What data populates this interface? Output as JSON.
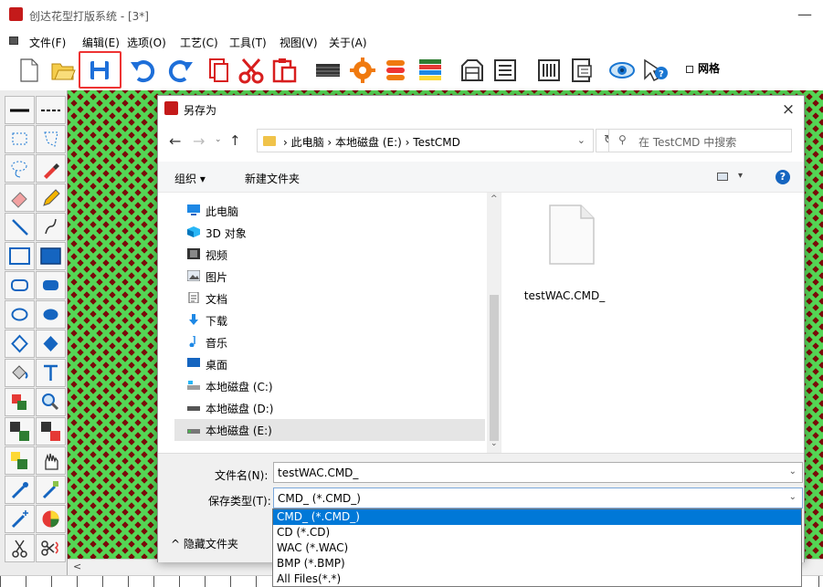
{
  "window": {
    "title": "创达花型打版系统 - [3*]",
    "minimize": "—"
  },
  "menu": [
    "文件(F)",
    "编辑(E)",
    "选项(O)",
    "工艺(C)",
    "工具(T)",
    "视图(V)",
    "关于(A)"
  ],
  "toolbar": {
    "icons": [
      "new-file-icon",
      "open-folder-icon",
      "save-icon",
      "undo-icon",
      "redo-icon",
      "copy-icon",
      "cut-icon",
      "paste-icon",
      "pattern-block-icon",
      "gear-icon",
      "color-sort-icon",
      "color-stripe-icon",
      "machine-icon",
      "list-icon",
      "barcode-icon",
      "print-preview-icon",
      "eye-icon",
      "help-cursor-icon"
    ],
    "grid_label": "网格",
    "colors": {
      "save_frame": "#ee3333",
      "save_icon": "#1e6fd9",
      "cut": "#d81e1e",
      "gear": "#f07a10"
    }
  },
  "left_tools": [
    "line-icon",
    "dashed-line-icon",
    "rect-select-icon",
    "poly-select-icon",
    "lasso-icon",
    "dropper-icon",
    "eraser-icon",
    "pencil-icon",
    "straight-line-icon",
    "curve-icon",
    "rectangle-outline-icon",
    "rectangle-fill-icon",
    "rounded-rect-outline-icon",
    "rounded-rect-fill-icon",
    "ellipse-outline-icon",
    "ellipse-fill-icon",
    "diamond-outline-icon",
    "diamond-fill-icon",
    "fill-bucket-icon",
    "text-icon",
    "color-swap-icon",
    "zoom-icon",
    "pattern-copy-icon",
    "pattern-move-icon",
    "color-replace-icon",
    "hand-icon",
    "spray-icon",
    "spray-brush-icon",
    "magic-icon",
    "color-wheel-icon",
    "scissors-icon",
    "cut-thread-icon"
  ],
  "canvas": {
    "colors": {
      "bg": "#7a0a0a",
      "diamond": "#55d655"
    },
    "hscroll_left": "<"
  },
  "dialog": {
    "title": "另存为",
    "close": "×",
    "address": {
      "crumbs": "›  此电脑  ›  本地磁盘 (E:)  ›  TestCMD",
      "dropdown": "⌄"
    },
    "refresh": "↻",
    "search_placeholder": "在 TestCMD 中搜索",
    "commands": {
      "organize": "组织 ▾",
      "new_folder": "新建文件夹",
      "view_dropdown": "▾",
      "help": "?"
    },
    "nav": [
      {
        "label": "此电脑",
        "icon": "computer-icon"
      },
      {
        "label": "3D 对象",
        "icon": "3d-objects-icon"
      },
      {
        "label": "视频",
        "icon": "video-icon"
      },
      {
        "label": "图片",
        "icon": "pictures-icon"
      },
      {
        "label": "文档",
        "icon": "documents-icon"
      },
      {
        "label": "下载",
        "icon": "download-icon"
      },
      {
        "label": "音乐",
        "icon": "music-icon"
      },
      {
        "label": "桌面",
        "icon": "desktop-icon"
      },
      {
        "label": "本地磁盘 (C:)",
        "icon": "drive-c-icon"
      },
      {
        "label": "本地磁盘 (D:)",
        "icon": "drive-d-icon"
      },
      {
        "label": "本地磁盘 (E:)",
        "icon": "drive-e-icon",
        "selected": true
      }
    ],
    "files": [
      {
        "name": "testWAC.CMD_",
        "icon": "file-icon"
      }
    ],
    "filename_label": "文件名(N):",
    "filename_value": "testWAC.CMD_",
    "filetype_label": "保存类型(T):",
    "filetype_value": "CMD_ (*.CMD_)",
    "filetype_options": [
      "CMD_ (*.CMD_)",
      "CD (*.CD)",
      "WAC (*.WAC)",
      "BMP (*.BMP)",
      "All Files(*.*)"
    ],
    "hide_folders": "^  隐藏文件夹"
  }
}
